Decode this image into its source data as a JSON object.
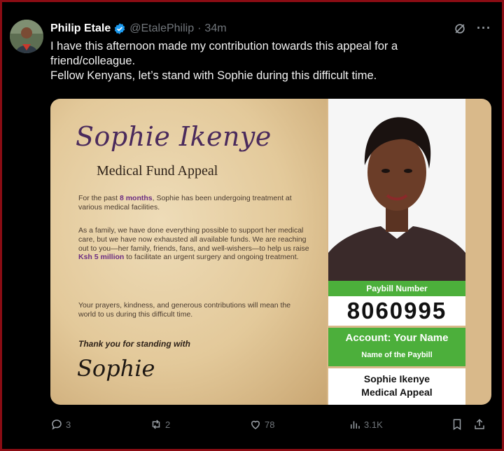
{
  "tweet": {
    "author_name": "Philip Etale",
    "handle": "@EtalePhilip",
    "separator": "·",
    "time": "34m",
    "text_lines": [
      "I have this afternoon made my contribution towards this appeal for a",
      "friend/colleague.",
      "Fellow Kenyans, let’s stand with Sophie during this difficult time."
    ]
  },
  "icons": {
    "verified": "verified-badge-icon",
    "grok": "grok-icon",
    "more": "more-icon",
    "reply": "reply-icon",
    "retweet": "retweet-icon",
    "like": "like-icon",
    "views": "views-icon",
    "bookmark": "bookmark-icon",
    "share": "share-icon"
  },
  "header_actions": {
    "more": "···"
  },
  "poster": {
    "title": "Sophie Ikenye",
    "subtitle": "Medical Fund Appeal",
    "para1_before": "For the past ",
    "para1_highlight": "8 months",
    "para1_after": ", Sophie has been undergoing treatment at various medical facilities.",
    "para2_before": "As a family, we have done everything possible to support her medical care, but we have now exhausted all available funds. We are reaching out to you—her family, friends, fans, and well-wishers—to help us raise ",
    "para2_highlight": "Ksh 5 million",
    "para2_after": " to facilitate an urgent surgery and ongoing treatment.",
    "para3": "Your prayers, kindness, and generous contributions will mean the world to us during this difficult time.",
    "thanks": "Thank you for standing with",
    "signature": "Sophie",
    "paybill_label": "Paybill Number",
    "paybill_number": "8060995",
    "account_label": "Account: Your Name",
    "paybill_name_label": "Name of the Paybill",
    "paybill_name_line1": "Sophie Ikenye",
    "paybill_name_line2": "Medical Appeal"
  },
  "actions": {
    "replies": "3",
    "retweets": "2",
    "likes": "78",
    "views": "3.1K"
  },
  "colors": {
    "background": "#000000",
    "frame_border": "#8b0c14",
    "verified_blue": "#1d9bf0",
    "muted_text": "#71767b",
    "paybill_green": "#4caf3b",
    "title_purple": "#4a2a5c",
    "highlight_purple": "#6b2d82"
  }
}
